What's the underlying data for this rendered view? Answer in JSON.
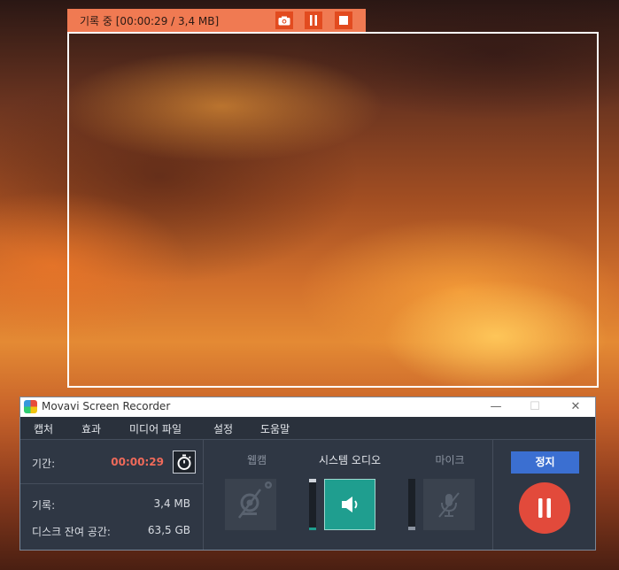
{
  "recording_toolbar": {
    "status_text": "기록 중 [00:00:29 / 3,4 MB]",
    "screenshot_icon": "camera-icon",
    "pause_icon": "pause-icon",
    "stop_icon": "stop-icon",
    "accent_color": "#f07a52"
  },
  "window": {
    "title": "Movavi Screen Recorder",
    "controls": {
      "minimize": "—",
      "maximize": "☐",
      "close": "✕"
    }
  },
  "menu": [
    "캡처",
    "효과",
    "미디어 파일",
    "설정",
    "도움말"
  ],
  "stats": {
    "duration_label": "기간:",
    "duration_value": "00:00:29",
    "recorded_label": "기록:",
    "recorded_value": "3,4 MB",
    "disk_label": "디스크 잔여 공간:",
    "disk_value": "63,5 GB"
  },
  "devices": {
    "webcam_label": "웹캠",
    "system_audio_label": "시스템 오디오",
    "microphone_label": "마이크",
    "webcam_enabled": false,
    "system_audio_enabled": true,
    "microphone_enabled": false
  },
  "actions": {
    "stop_label": "정지",
    "pause_icon": "pause-icon"
  },
  "colors": {
    "duration_red": "#f06a5a",
    "active_teal": "#1f9e8f",
    "stop_blue": "#3b6fd1",
    "pause_red": "#e24a3b"
  }
}
